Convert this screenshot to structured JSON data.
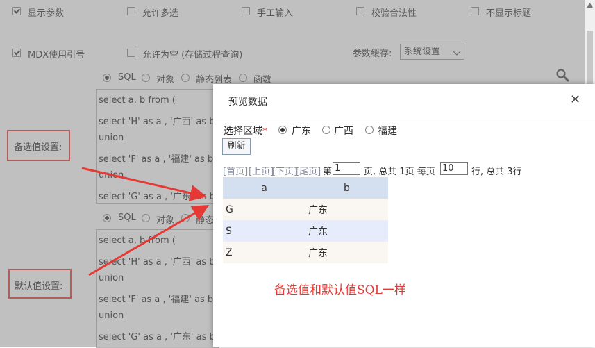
{
  "options": {
    "show_params": "显示参数",
    "allow_multi": "允许多选",
    "manual_input": "手工输入",
    "validate": "校验合法性",
    "hide_title": "不显示标题",
    "mdx_quote": "MDX使用引号",
    "allow_null": "允许为空 (存储过程查询)",
    "param_cache_label": "参数缓存:",
    "param_cache_value": "系统设置"
  },
  "source_types": [
    "SQL",
    "对象",
    "静态列表",
    "函数"
  ],
  "candidate": {
    "label": "备选值设置:",
    "lines": [
      "select a, b from (",
      "select 'H' as a , '广西' as b",
      "union",
      "select 'F' as a , '福建' as b",
      "union",
      "select 'G' as a , '广东' as b"
    ]
  },
  "default": {
    "label": "默认值设置:",
    "lines": [
      "select a, b from (",
      "select 'H' as a , '广西' as b",
      "union",
      "select 'F' as a , '福建' as b",
      "union",
      "select 'G' as a , '广东' as b"
    ]
  },
  "modal": {
    "title": "预览数据",
    "close": "✕",
    "region_label": "选择区域",
    "required_mark": "*",
    "regions": [
      "广东",
      "广西",
      "福建"
    ],
    "selected_region": "广东",
    "refresh": "刷新",
    "pager": {
      "first": "[首页]",
      "prev": "[上页]",
      "next": "[下页]",
      "last": "[尾页]",
      "page_prefix": "第",
      "page_value": "1",
      "page_suffix": "页, 总共 1页 每页",
      "per_page_value": "10",
      "total_text": "行, 总共 3行"
    },
    "table": {
      "headers": [
        "a",
        "b"
      ],
      "rows": [
        [
          "G",
          "广东"
        ],
        [
          "S",
          "广东"
        ],
        [
          "Z",
          "广东"
        ]
      ]
    },
    "annotation": "备选值和默认值SQL一样"
  },
  "colors": {
    "annotation_red": "#e53935",
    "header_blue": "#d4dff0",
    "row_highlight": "#e6ecfb"
  }
}
